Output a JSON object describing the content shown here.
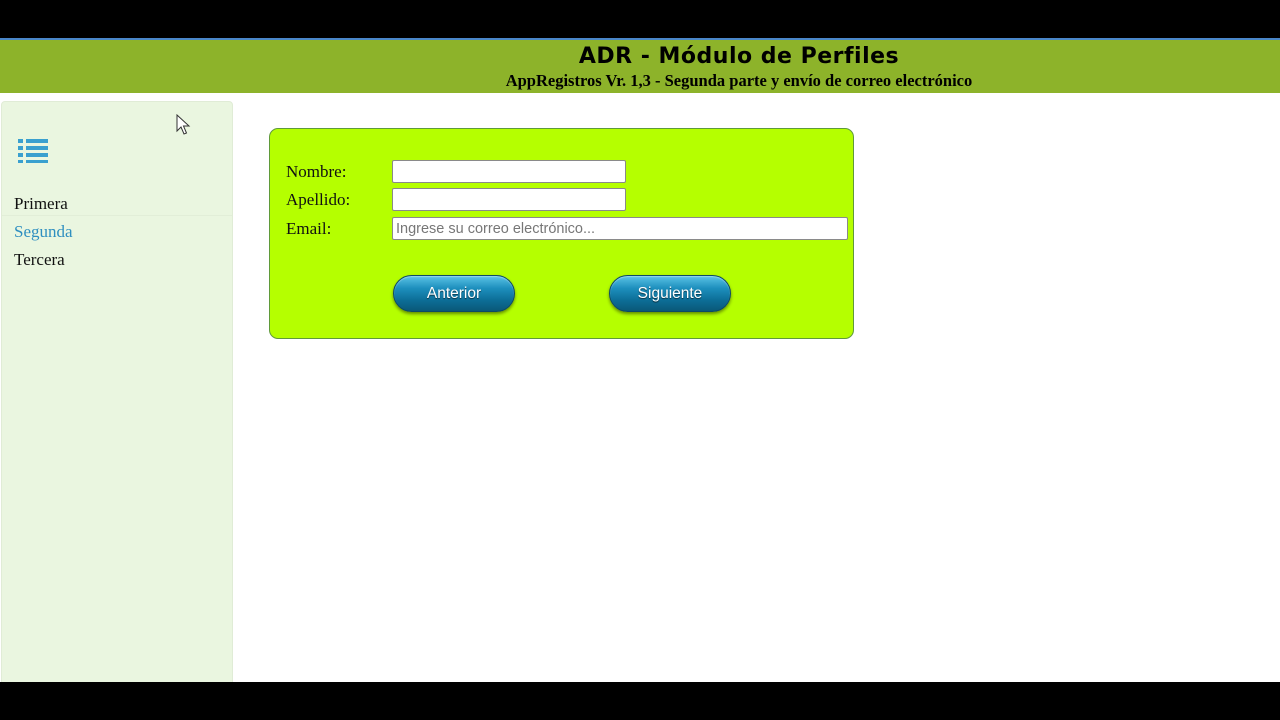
{
  "header": {
    "title": "ADR - Módulo de Perfiles",
    "subtitle": "AppRegistros Vr. 1,3 - Segunda parte y envío de correo electrónico"
  },
  "sidebar": {
    "menu_icon": "list-icon",
    "items": [
      {
        "label": "Primera",
        "active": false
      },
      {
        "label": "Segunda",
        "active": true
      },
      {
        "label": "Tercera",
        "active": false
      }
    ]
  },
  "form": {
    "nombre_label": "Nombre:",
    "nombre_value": "",
    "apellido_label": "Apellido:",
    "apellido_value": "",
    "email_label": "Email:",
    "email_placeholder": "Ingrese su correo electrónico...",
    "prev_button": "Anterior",
    "next_button": "Siguiente"
  },
  "colors": {
    "header_bg": "#8db32a",
    "sidebar_bg": "#eaf6e0",
    "form_bg": "#b5ff00",
    "active_link": "#2f8fc0",
    "button": "#0c6d96"
  },
  "cursor_icon": "mouse-pointer-icon"
}
